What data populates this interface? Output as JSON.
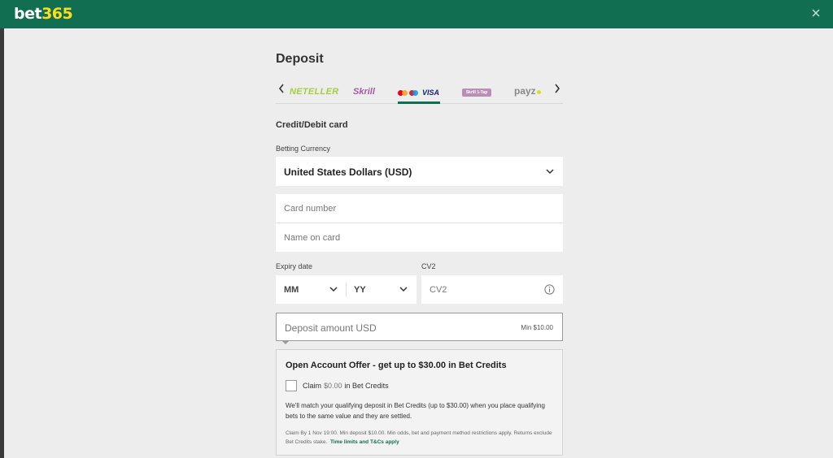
{
  "header": {
    "logo_prefix": "bet",
    "logo_suffix": "365"
  },
  "page": {
    "title": "Deposit"
  },
  "payment_methods": {
    "items": [
      {
        "label": "NETELLER"
      },
      {
        "label": "Skrill"
      },
      {
        "label": "VISA",
        "selected": true
      },
      {
        "label": "Skrill 1-Tap"
      },
      {
        "label": "payz"
      }
    ]
  },
  "form": {
    "section_title": "Credit/Debit card",
    "currency_label": "Betting Currency",
    "currency_value": "United States Dollars (USD)",
    "card_number_placeholder": "Card number",
    "name_on_card_placeholder": "Name on card",
    "expiry_label": "Expiry date",
    "month_value": "MM",
    "year_value": "YY",
    "cv2_label": "CV2",
    "cv2_placeholder": "CV2",
    "deposit_placeholder": "Deposit amount USD",
    "deposit_min": "Min $10.00"
  },
  "offer": {
    "title": "Open Account Offer - get up to $30.00 in Bet Credits",
    "claim_label": "Claim",
    "claim_amount": "$0.00",
    "claim_suffix": "in Bet Credits",
    "description": "We'll match your qualifying deposit in Bet Credits (up to $30.00) when you place qualifying bets to the same value and they are settled.",
    "fine_print": "Claim By 1 Nov 19:00. Min deposit $10.00. Min odds, bet and payment method restrictions apply. Returns exclude Bet Credits stake.",
    "terms_link": "Time limits and T&Cs apply"
  },
  "colors": {
    "brand_green": "#126e51",
    "logo_yellow": "#ffdf1b",
    "background": "#ecedec"
  }
}
